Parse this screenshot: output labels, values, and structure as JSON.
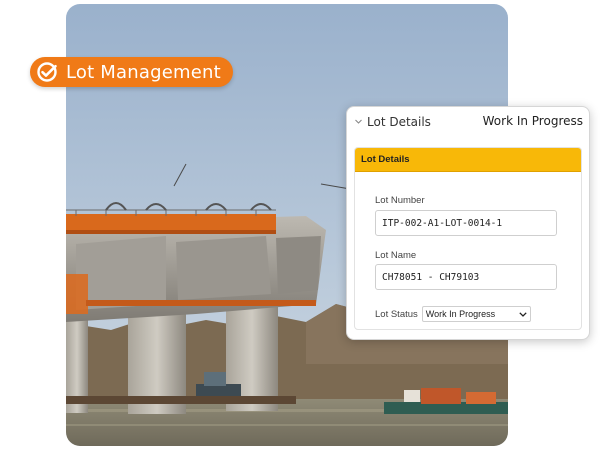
{
  "badge": {
    "label": "Lot Management",
    "icon": "check-circle-icon",
    "color": "#f07a17"
  },
  "panel": {
    "title": "Lot Details",
    "status": "Work In Progress",
    "card": {
      "header": "Lot Details",
      "header_color": "#f8b808",
      "lot_number_label": "Lot Number",
      "lot_number_value": "ITP-002-A1-LOT-0014-1",
      "lot_name_label": "Lot Name",
      "lot_name_value": "CH78051 - CH79103",
      "lot_status_label": "Lot Status",
      "lot_status_value": "Work In Progress"
    }
  }
}
